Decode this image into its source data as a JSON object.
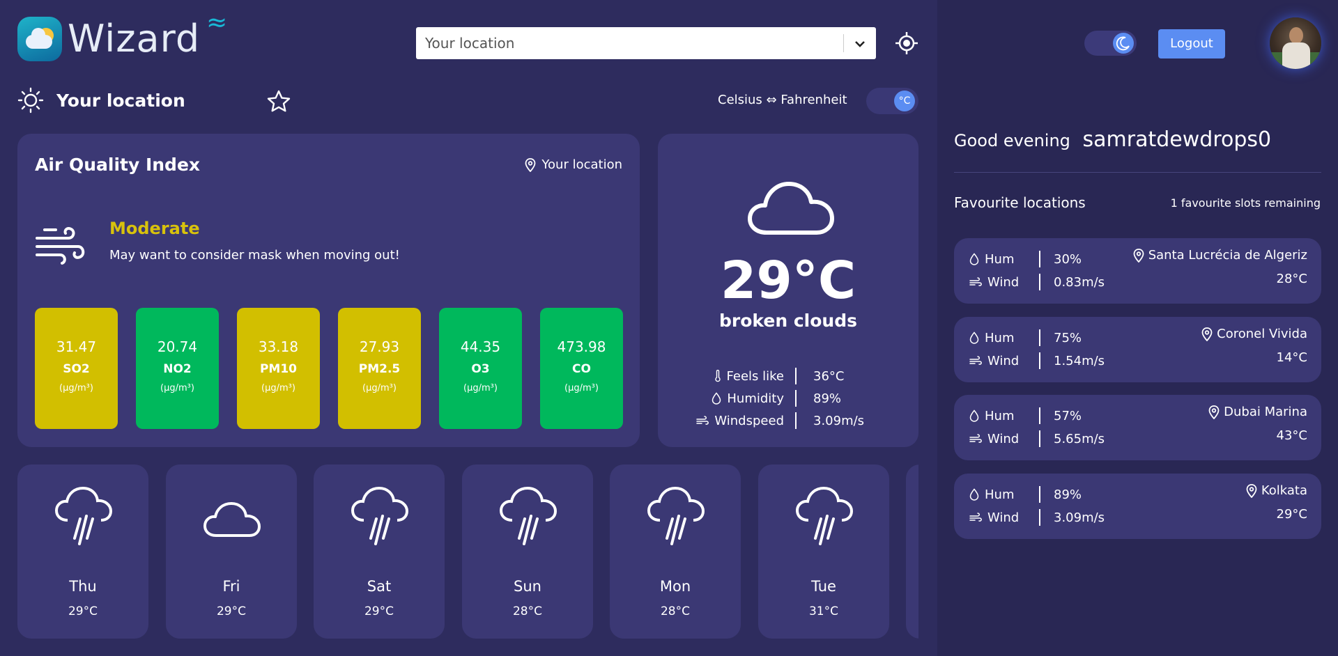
{
  "app": {
    "name": "Wizard"
  },
  "search": {
    "value": "Your location",
    "chevron": "chevron-down-icon"
  },
  "location": {
    "title": "Your location"
  },
  "units": {
    "label": "Celsius ⇔ Fahrenheit",
    "toggle_value": "°C"
  },
  "aqi": {
    "title": "Air Quality Index",
    "location": "Your location",
    "level": "Moderate",
    "level_color": "#d8c20c",
    "message": "May want to consider mask when moving out!",
    "pollutants": [
      {
        "value": "31.47",
        "name": "SO2",
        "unit": "(μg/m³)",
        "color": "#d2bf00"
      },
      {
        "value": "20.74",
        "name": "NO2",
        "unit": "(μg/m³)",
        "color": "#00b85c"
      },
      {
        "value": "33.18",
        "name": "PM10",
        "unit": "(μg/m³)",
        "color": "#d2bf00"
      },
      {
        "value": "27.93",
        "name": "PM2.5",
        "unit": "(μg/m³)",
        "color": "#d2bf00"
      },
      {
        "value": "44.35",
        "name": "O3",
        "unit": "(μg/m³)",
        "color": "#00b85c"
      },
      {
        "value": "473.98",
        "name": "CO",
        "unit": "(μg/m³)",
        "color": "#00b85c"
      }
    ]
  },
  "current": {
    "temp": "29°C",
    "condition": "broken clouds",
    "icon": "cloud-icon",
    "metrics": [
      {
        "label": "Feels like",
        "value": "36°C",
        "icon": "thermometer-icon"
      },
      {
        "label": "Humidity",
        "value": "89%",
        "icon": "droplet-icon"
      },
      {
        "label": "Windspeed",
        "value": "3.09m/s",
        "icon": "wind-icon"
      }
    ]
  },
  "forecast": [
    {
      "day": "Thu",
      "temp": "29°C",
      "icon": "rain-icon"
    },
    {
      "day": "Fri",
      "temp": "29°C",
      "icon": "cloud-icon"
    },
    {
      "day": "Sat",
      "temp": "29°C",
      "icon": "rain-icon"
    },
    {
      "day": "Sun",
      "temp": "28°C",
      "icon": "rain-icon"
    },
    {
      "day": "Mon",
      "temp": "28°C",
      "icon": "rain-icon"
    },
    {
      "day": "Tue",
      "temp": "31°C",
      "icon": "rain-icon"
    }
  ],
  "sidebar": {
    "logout": "Logout",
    "greeting": "Good evening",
    "username": "samratdewdrops0",
    "favourites_title": "Favourite locations",
    "slots_remaining": "1 favourite slots remaining",
    "hum_label": "Hum",
    "wind_label": "Wind",
    "favourites": [
      {
        "place": "Santa Lucrécia de Algeriz",
        "hum": "30%",
        "wind": "0.83m/s",
        "temp": "28°C"
      },
      {
        "place": "Coronel Vivida",
        "hum": "75%",
        "wind": "1.54m/s",
        "temp": "14°C"
      },
      {
        "place": "Dubai Marina",
        "hum": "57%",
        "wind": "5.65m/s",
        "temp": "43°C"
      },
      {
        "place": "Kolkata",
        "hum": "89%",
        "wind": "3.09m/s",
        "temp": "29°C"
      }
    ]
  },
  "colors": {
    "background": "#2e2c5e",
    "card": "#3b3874",
    "accent": "#5b8df2"
  }
}
